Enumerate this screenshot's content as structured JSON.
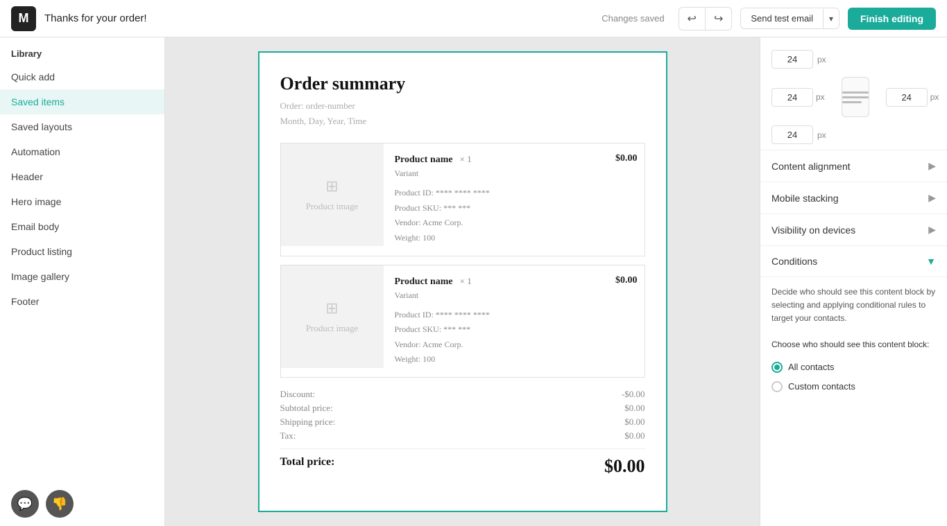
{
  "topbar": {
    "logo_text": "M",
    "title": "Thanks for your order!",
    "status": "Changes saved",
    "undo_icon": "↩",
    "redo_icon": "↪",
    "send_test_label": "Send test email",
    "send_arrow": "▾",
    "finish_label": "Finish editing"
  },
  "sidebar": {
    "library_label": "Library",
    "items": [
      {
        "id": "quick-add",
        "label": "Quick add"
      },
      {
        "id": "saved-items",
        "label": "Saved items"
      },
      {
        "id": "saved-layouts",
        "label": "Saved layouts"
      },
      {
        "id": "automation",
        "label": "Automation"
      },
      {
        "id": "header",
        "label": "Header"
      },
      {
        "id": "hero-image",
        "label": "Hero image"
      },
      {
        "id": "email-body",
        "label": "Email body"
      },
      {
        "id": "product-listing",
        "label": "Product listing"
      },
      {
        "id": "image-gallery",
        "label": "Image gallery"
      },
      {
        "id": "footer",
        "label": "Footer"
      }
    ],
    "chat_icon": "💬",
    "feedback_icon": "👎"
  },
  "email": {
    "title": "Order summary",
    "order_number_label": "Order: order-number",
    "order_date_label": "Month, Day, Year, Time",
    "products": [
      {
        "name": "Product name",
        "qty": "× 1",
        "price": "$0.00",
        "variant": "Variant",
        "id_line": "Product ID: **** **** ****",
        "sku_line": "Product SKU: *** ***",
        "vendor_line": "Vendor: Acme Corp.",
        "weight_line": "Weight: 100",
        "image_label": "Product image"
      },
      {
        "name": "Product name",
        "qty": "× 1",
        "price": "$0.00",
        "variant": "Variant",
        "id_line": "Product ID: **** **** ****",
        "sku_line": "Product SKU: *** ***",
        "vendor_line": "Vendor: Acme Corp.",
        "weight_line": "Weight: 100",
        "image_label": "Product image"
      }
    ],
    "discount_label": "Discount:",
    "discount_value": "-$0.00",
    "subtotal_label": "Subtotal price:",
    "subtotal_value": "$0.00",
    "shipping_label": "Shipping price:",
    "shipping_value": "$0.00",
    "tax_label": "Tax:",
    "tax_value": "$0.00",
    "total_label": "Total price:",
    "total_value": "$0.00"
  },
  "right_panel": {
    "padding_values": {
      "top": "24",
      "right": "24",
      "bottom": "24",
      "left": "24",
      "px_label": "px"
    },
    "sections": [
      {
        "id": "content-alignment",
        "label": "Content alignment",
        "icon": "▶",
        "expanded": false
      },
      {
        "id": "mobile-stacking",
        "label": "Mobile stacking",
        "icon": "▶",
        "expanded": false
      },
      {
        "id": "visibility-on-devices",
        "label": "Visibility on devices",
        "icon": "▶",
        "expanded": false
      },
      {
        "id": "conditions",
        "label": "Conditions",
        "icon": "▼",
        "expanded": true
      }
    ],
    "conditions": {
      "description": "Decide who should see this content block by selecting and applying conditional rules to target your contacts.",
      "choose_label": "Choose who should see this content block:",
      "options": [
        {
          "id": "all-contacts",
          "label": "All contacts",
          "selected": true
        },
        {
          "id": "custom-contacts",
          "label": "Custom contacts",
          "selected": false
        }
      ]
    }
  }
}
